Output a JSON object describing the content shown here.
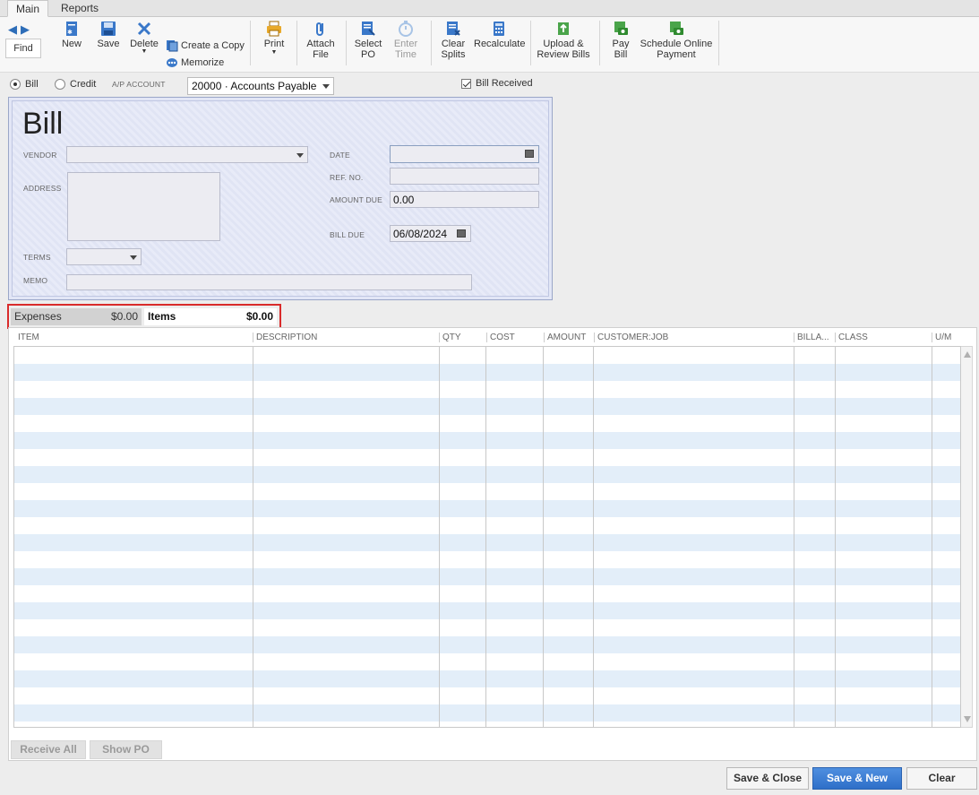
{
  "tabs": {
    "main": "Main",
    "reports": "Reports"
  },
  "toolbar": {
    "find": "Find",
    "new": "New",
    "save": "Save",
    "delete": "Delete",
    "create_copy": "Create a Copy",
    "memorize": "Memorize",
    "print": "Print",
    "attach_file_1": "Attach",
    "attach_file_2": "File",
    "select_po_1": "Select",
    "select_po_2": "PO",
    "enter_time_1": "Enter",
    "enter_time_2": "Time",
    "clear_splits_1": "Clear",
    "clear_splits_2": "Splits",
    "recalculate": "Recalculate",
    "upload_1": "Upload &",
    "upload_2": "Review Bills",
    "pay_bill_1": "Pay",
    "pay_bill_2": "Bill",
    "schedule_1": "Schedule Online",
    "schedule_2": "Payment"
  },
  "form": {
    "bill_radio": "Bill",
    "credit_radio": "Credit",
    "ap_account_label": "A/P ACCOUNT",
    "ap_account_value": "20000 · Accounts Payable",
    "bill_received": "Bill Received",
    "title": "Bill",
    "vendor_label": "VENDOR",
    "address_label": "ADDRESS",
    "terms_label": "TERMS",
    "memo_label": "MEMO",
    "date_label": "DATE",
    "ref_label": "REF. NO.",
    "amount_due_label": "AMOUNT DUE",
    "amount_due_value": "0.00",
    "bill_due_label": "BILL DUE",
    "bill_due_value": "06/08/2024"
  },
  "detail_tabs": {
    "expenses_label": "Expenses",
    "expenses_total": "$0.00",
    "items_label": "Items",
    "items_total": "$0.00"
  },
  "grid": {
    "columns": [
      "ITEM",
      "DESCRIPTION",
      "QTY",
      "COST",
      "AMOUNT",
      "CUSTOMER:JOB",
      "BILLA...",
      "CLASS",
      "U/M"
    ]
  },
  "grid_buttons": {
    "receive_all": "Receive All",
    "show_po": "Show PO"
  },
  "footer": {
    "save_close": "Save & Close",
    "save_new": "Save & New",
    "clear": "Clear"
  },
  "colors": {
    "highlight": "#d92b2b",
    "primary": "#2e6fc8",
    "row_alt": "#e3eef9"
  }
}
